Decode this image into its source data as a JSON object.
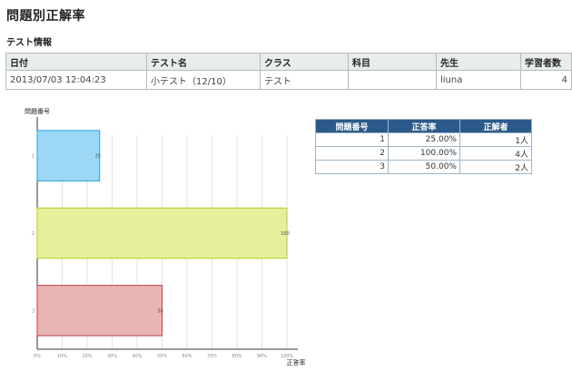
{
  "page": {
    "title": "問題別正解率"
  },
  "test_info": {
    "section_title": "テスト情報",
    "headers": [
      "日付",
      "テスト名",
      "クラス",
      "科目",
      "先生",
      "学習者数"
    ],
    "row": [
      "2013/07/03 12:04:23",
      "小テスト（12/10）",
      "テスト",
      "",
      "liuna",
      "4"
    ]
  },
  "results_table": {
    "headers": [
      "問題番号",
      "正答率",
      "正解者"
    ],
    "rows": [
      [
        "1",
        "25.00%",
        "1人"
      ],
      [
        "2",
        "100.00%",
        "4人"
      ],
      [
        "3",
        "50.00%",
        "2人"
      ]
    ]
  },
  "chart_data": {
    "type": "bar",
    "orientation": "horizontal",
    "ylabel": "問題番号",
    "xlabel": "正答率",
    "categories": [
      "1",
      "2",
      "3"
    ],
    "values": [
      25,
      100,
      50
    ],
    "value_labels": [
      "25",
      "100",
      "50"
    ],
    "xlim": [
      0,
      100
    ],
    "x_ticks": [
      "0%",
      "10%",
      "20%",
      "30%",
      "40%",
      "50%",
      "60%",
      "70%",
      "80%",
      "90%",
      "100%"
    ],
    "grid": true,
    "bar_colors": [
      {
        "fill": "#9cd8f5",
        "stroke": "#2a9fd6"
      },
      {
        "fill": "#e7ef9c",
        "stroke": "#b7c92a"
      },
      {
        "fill": "#e8b4b4",
        "stroke": "#c0404a"
      }
    ]
  }
}
